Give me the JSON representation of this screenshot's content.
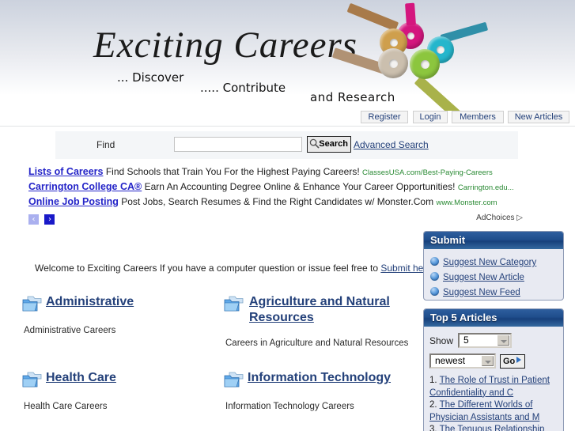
{
  "header": {
    "wordmark": "Exciting Careers",
    "tagline_1": "... Discover",
    "tagline_2": "..... Contribute",
    "tagline_3": "and  Research",
    "keys_icon": "keys-graphic"
  },
  "nav": {
    "items": [
      {
        "label": "Register"
      },
      {
        "label": "Login"
      },
      {
        "label": "Members"
      },
      {
        "label": "New Articles"
      }
    ]
  },
  "search": {
    "find_label": "Find",
    "input_value": "",
    "input_placeholder": "",
    "button_label": "Search",
    "button_icon": "magnifier-icon",
    "advanced_label": "Advanced Search"
  },
  "ads": {
    "rows": [
      {
        "title": "Lists of Careers",
        "body": "Find Schools that Train You For the Highest Paying Careers!",
        "url": "ClassesUSA.com/Best-Paying-Careers"
      },
      {
        "title": "Carrington College CA®",
        "body": "Earn An Accounting Degree Online & Enhance Your Career Opportunities!",
        "url": "Carrington.edu..."
      },
      {
        "title": "Online Job Posting",
        "body": "Post Jobs, Search Resumes & Find the Right Candidates w/ Monster.Com",
        "url": "www.Monster.com"
      }
    ],
    "prev_arrow": "‹",
    "next_arrow": "›",
    "adchoices_label": "AdChoices"
  },
  "main": {
    "welcome_text": "Welcome to Exciting Careers If you have a computer question or issue feel free to ",
    "welcome_link": "Submit here",
    "categories": [
      {
        "title": "Administrative",
        "description": "Administrative Careers"
      },
      {
        "title": "Agriculture and Natural Resources",
        "description": "Careers in Agriculture and Natural Resources"
      },
      {
        "title": "Health Care",
        "description": "Health Care Careers"
      },
      {
        "title": "Information Technology",
        "description": "Information Technology Careers"
      }
    ]
  },
  "sidebar": {
    "submit_panel": {
      "title": "Submit",
      "items": [
        {
          "label": "Suggest New Category"
        },
        {
          "label": "Suggest New Article"
        },
        {
          "label": "Suggest New Feed"
        }
      ]
    },
    "top5_panel": {
      "title": "Top 5 Articles",
      "show_label": "Show",
      "count_value": "5",
      "sort_value": "newest",
      "go_label": "Go",
      "articles": [
        {
          "num": "1.",
          "title": "The Role of Trust in Patient Confidentiality and C"
        },
        {
          "num": "2.",
          "title": "The Different Worlds of Physician Assistants and M"
        },
        {
          "num": "3.",
          "title": "The Tenuous Relationship"
        }
      ]
    }
  },
  "colors": {
    "link": "#24417a",
    "ad_title": "#2424c8",
    "ad_url": "#2a8a34",
    "panel_header": "#1f4d8c",
    "panel_bg": "#e8eaf2"
  }
}
